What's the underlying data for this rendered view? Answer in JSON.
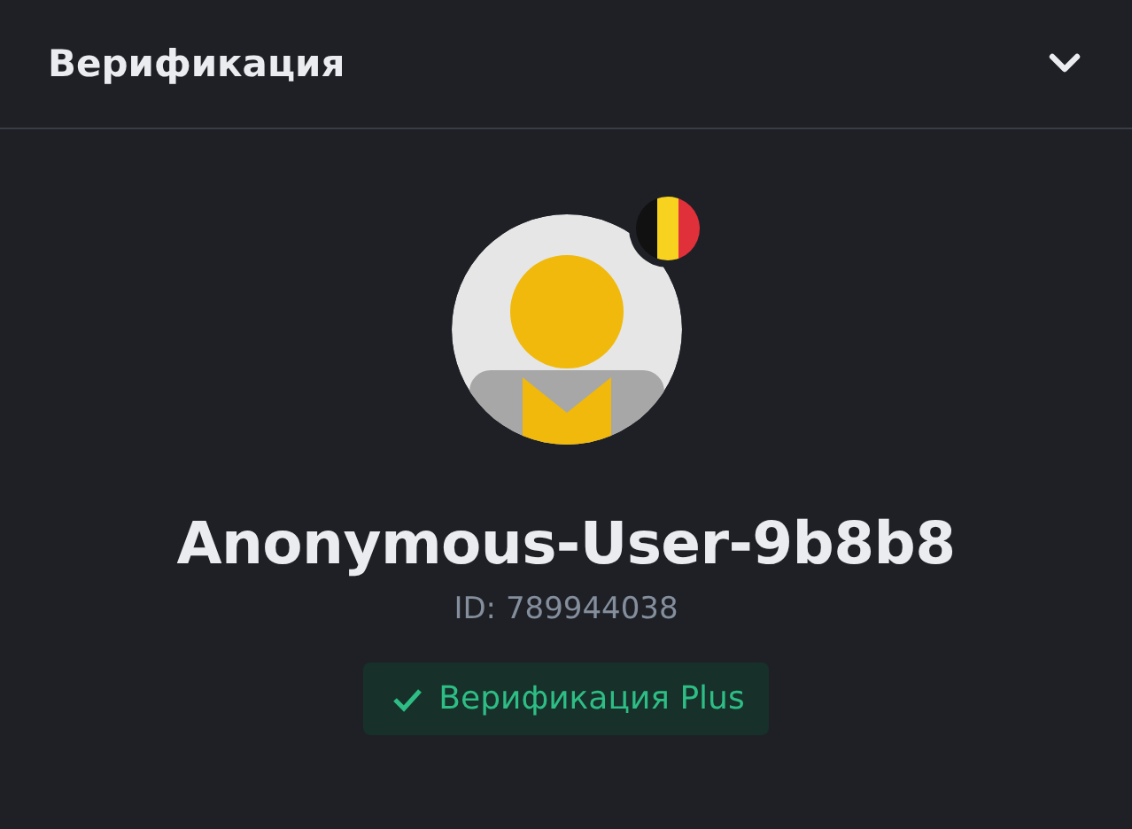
{
  "header": {
    "title": "Верификация"
  },
  "profile": {
    "name": "Anonymous-User-9b8b8",
    "id_label": "ID: 789944038"
  },
  "badge": {
    "label": "Верификация Plus"
  }
}
